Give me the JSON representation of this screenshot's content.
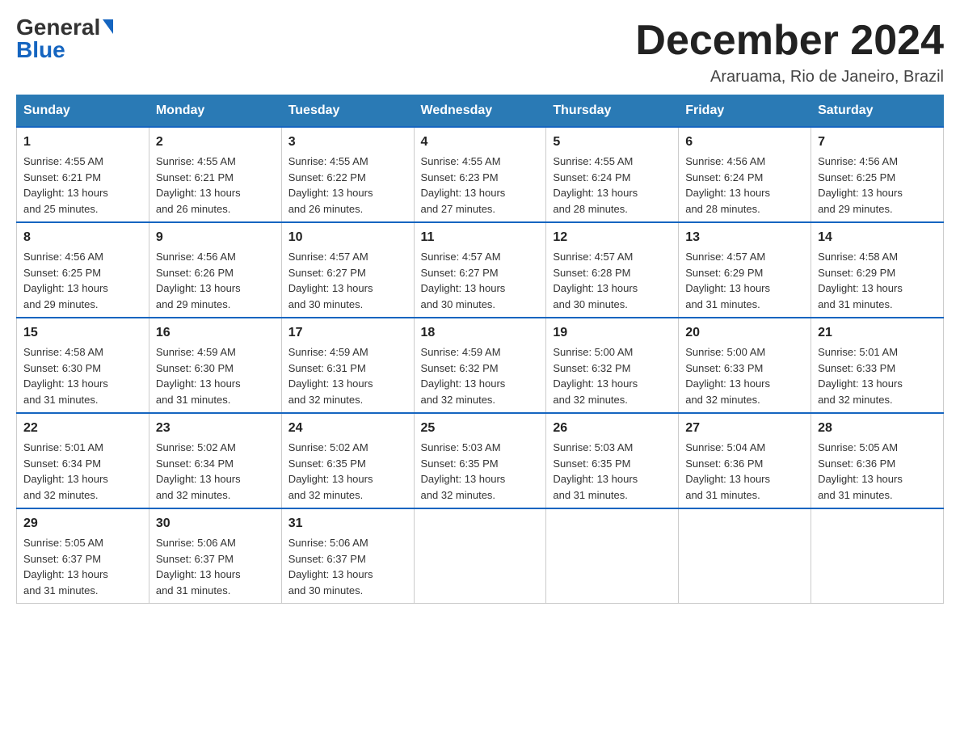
{
  "logo": {
    "line1": "General",
    "line2": "Blue"
  },
  "header": {
    "title": "December 2024",
    "subtitle": "Araruama, Rio de Janeiro, Brazil"
  },
  "days": [
    "Sunday",
    "Monday",
    "Tuesday",
    "Wednesday",
    "Thursday",
    "Friday",
    "Saturday"
  ],
  "weeks": [
    [
      {
        "date": "1",
        "sunrise": "4:55 AM",
        "sunset": "6:21 PM",
        "daylight": "13 hours and 25 minutes."
      },
      {
        "date": "2",
        "sunrise": "4:55 AM",
        "sunset": "6:21 PM",
        "daylight": "13 hours and 26 minutes."
      },
      {
        "date": "3",
        "sunrise": "4:55 AM",
        "sunset": "6:22 PM",
        "daylight": "13 hours and 26 minutes."
      },
      {
        "date": "4",
        "sunrise": "4:55 AM",
        "sunset": "6:23 PM",
        "daylight": "13 hours and 27 minutes."
      },
      {
        "date": "5",
        "sunrise": "4:55 AM",
        "sunset": "6:24 PM",
        "daylight": "13 hours and 28 minutes."
      },
      {
        "date": "6",
        "sunrise": "4:56 AM",
        "sunset": "6:24 PM",
        "daylight": "13 hours and 28 minutes."
      },
      {
        "date": "7",
        "sunrise": "4:56 AM",
        "sunset": "6:25 PM",
        "daylight": "13 hours and 29 minutes."
      }
    ],
    [
      {
        "date": "8",
        "sunrise": "4:56 AM",
        "sunset": "6:25 PM",
        "daylight": "13 hours and 29 minutes."
      },
      {
        "date": "9",
        "sunrise": "4:56 AM",
        "sunset": "6:26 PM",
        "daylight": "13 hours and 29 minutes."
      },
      {
        "date": "10",
        "sunrise": "4:57 AM",
        "sunset": "6:27 PM",
        "daylight": "13 hours and 30 minutes."
      },
      {
        "date": "11",
        "sunrise": "4:57 AM",
        "sunset": "6:27 PM",
        "daylight": "13 hours and 30 minutes."
      },
      {
        "date": "12",
        "sunrise": "4:57 AM",
        "sunset": "6:28 PM",
        "daylight": "13 hours and 30 minutes."
      },
      {
        "date": "13",
        "sunrise": "4:57 AM",
        "sunset": "6:29 PM",
        "daylight": "13 hours and 31 minutes."
      },
      {
        "date": "14",
        "sunrise": "4:58 AM",
        "sunset": "6:29 PM",
        "daylight": "13 hours and 31 minutes."
      }
    ],
    [
      {
        "date": "15",
        "sunrise": "4:58 AM",
        "sunset": "6:30 PM",
        "daylight": "13 hours and 31 minutes."
      },
      {
        "date": "16",
        "sunrise": "4:59 AM",
        "sunset": "6:30 PM",
        "daylight": "13 hours and 31 minutes."
      },
      {
        "date": "17",
        "sunrise": "4:59 AM",
        "sunset": "6:31 PM",
        "daylight": "13 hours and 32 minutes."
      },
      {
        "date": "18",
        "sunrise": "4:59 AM",
        "sunset": "6:32 PM",
        "daylight": "13 hours and 32 minutes."
      },
      {
        "date": "19",
        "sunrise": "5:00 AM",
        "sunset": "6:32 PM",
        "daylight": "13 hours and 32 minutes."
      },
      {
        "date": "20",
        "sunrise": "5:00 AM",
        "sunset": "6:33 PM",
        "daylight": "13 hours and 32 minutes."
      },
      {
        "date": "21",
        "sunrise": "5:01 AM",
        "sunset": "6:33 PM",
        "daylight": "13 hours and 32 minutes."
      }
    ],
    [
      {
        "date": "22",
        "sunrise": "5:01 AM",
        "sunset": "6:34 PM",
        "daylight": "13 hours and 32 minutes."
      },
      {
        "date": "23",
        "sunrise": "5:02 AM",
        "sunset": "6:34 PM",
        "daylight": "13 hours and 32 minutes."
      },
      {
        "date": "24",
        "sunrise": "5:02 AM",
        "sunset": "6:35 PM",
        "daylight": "13 hours and 32 minutes."
      },
      {
        "date": "25",
        "sunrise": "5:03 AM",
        "sunset": "6:35 PM",
        "daylight": "13 hours and 32 minutes."
      },
      {
        "date": "26",
        "sunrise": "5:03 AM",
        "sunset": "6:35 PM",
        "daylight": "13 hours and 31 minutes."
      },
      {
        "date": "27",
        "sunrise": "5:04 AM",
        "sunset": "6:36 PM",
        "daylight": "13 hours and 31 minutes."
      },
      {
        "date": "28",
        "sunrise": "5:05 AM",
        "sunset": "6:36 PM",
        "daylight": "13 hours and 31 minutes."
      }
    ],
    [
      {
        "date": "29",
        "sunrise": "5:05 AM",
        "sunset": "6:37 PM",
        "daylight": "13 hours and 31 minutes."
      },
      {
        "date": "30",
        "sunrise": "5:06 AM",
        "sunset": "6:37 PM",
        "daylight": "13 hours and 31 minutes."
      },
      {
        "date": "31",
        "sunrise": "5:06 AM",
        "sunset": "6:37 PM",
        "daylight": "13 hours and 30 minutes."
      },
      null,
      null,
      null,
      null
    ]
  ]
}
